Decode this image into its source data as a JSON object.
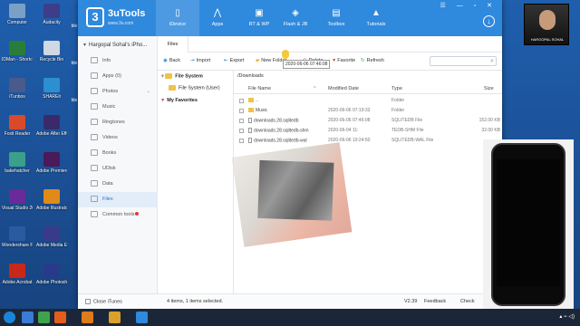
{
  "desktop": {
    "icons": [
      {
        "label": "Computer"
      },
      {
        "label": "Audacity"
      },
      {
        "label": "IDMan - Shortcut"
      },
      {
        "label": "Recycle Bin"
      },
      {
        "label": "iTunbos"
      },
      {
        "label": "SHAREit"
      },
      {
        "label": "Foxit Reader"
      },
      {
        "label": "Adobe After Effects CC"
      },
      {
        "label": "bakehatcher"
      },
      {
        "label": "Adobe Premiere Pro"
      },
      {
        "label": "Visual Studio 2017"
      },
      {
        "label": "Adobe Illustrator"
      },
      {
        "label": "Wondershare Filmora"
      },
      {
        "label": "Adobe Media Encoder CC"
      },
      {
        "label": "Adobe Acrobat"
      },
      {
        "label": "Adobe Photoshop"
      }
    ],
    "right_edge_labels": [
      "ble",
      "ble",
      "ble"
    ]
  },
  "app": {
    "brand": "3uTools",
    "brand_url": "www.3u.com",
    "logo_char": "3",
    "nav": [
      {
        "label": "iDevice",
        "icon": "phone-icon"
      },
      {
        "label": "Apps",
        "icon": "apps-icon"
      },
      {
        "label": "RT & WP",
        "icon": "ringtone-icon"
      },
      {
        "label": "Flash & JB",
        "icon": "shield-icon"
      },
      {
        "label": "Toolbox",
        "icon": "toolbox-icon"
      },
      {
        "label": "Tutorials",
        "icon": "graduation-cap-icon"
      }
    ],
    "window_buttons": "☰ — ▫ ✕"
  },
  "sidebar": {
    "device_name": "Hargopal Sohal's iPho...",
    "items": [
      {
        "label": "Info"
      },
      {
        "label": "Apps",
        "count": "(0)"
      },
      {
        "label": "Photos"
      },
      {
        "label": "Music"
      },
      {
        "label": "Ringtones"
      },
      {
        "label": "Videos"
      },
      {
        "label": "Books"
      },
      {
        "label": "UDisk"
      },
      {
        "label": "Data"
      },
      {
        "label": "Files"
      },
      {
        "label": "Common tools"
      }
    ]
  },
  "tabs": [
    {
      "label": "Files"
    }
  ],
  "toolbar": {
    "back": "Back",
    "import": "Import",
    "export": "Export",
    "new_folder": "New Folder",
    "delete": "Delete",
    "favorite": "Favorite",
    "refresh": "Refresh",
    "search_placeholder": ""
  },
  "tree": {
    "file_system": "File System",
    "file_system_user": "File System (User)",
    "my_favorites": "My Favorites"
  },
  "files": {
    "path": "/Downloads",
    "columns": {
      "name": "File Name",
      "modified": "Modified Date",
      "type": "Type",
      "size": "Size"
    },
    "rows": [
      {
        "name": "..",
        "modified": "",
        "type": "Folder",
        "size": "",
        "kind": "folder"
      },
      {
        "name": "Music",
        "modified": "2020-06-06 07:19:33",
        "type": "Folder",
        "size": "",
        "kind": "folder"
      },
      {
        "name": "downloads.28.sqlitedb",
        "modified": "2020-06-06 07:46:08",
        "type": "SQLITEDB File",
        "size": "152.00 KB",
        "kind": "doc"
      },
      {
        "name": "downloads.28.sqlitedb-shm",
        "modified": "2020-06-04 11:",
        "type": "TEDB-SHM File",
        "size": "32.00 KB",
        "kind": "doc"
      },
      {
        "name": "downloads.28.sqlitedb-wal",
        "modified": "2020-06-06 19:24:50",
        "type": "SQLITEDB-WAL File",
        "size": "",
        "kind": "doc"
      }
    ],
    "tooltip": "2020-06-06 07:46:08"
  },
  "status": {
    "close_itunes": "Close iTunes",
    "summary": "4 items, 1 items selected.",
    "version": "V2.39",
    "feedback": "Feedback",
    "check": "Check"
  },
  "webcam_label": "HARGOPAL SOHAL"
}
